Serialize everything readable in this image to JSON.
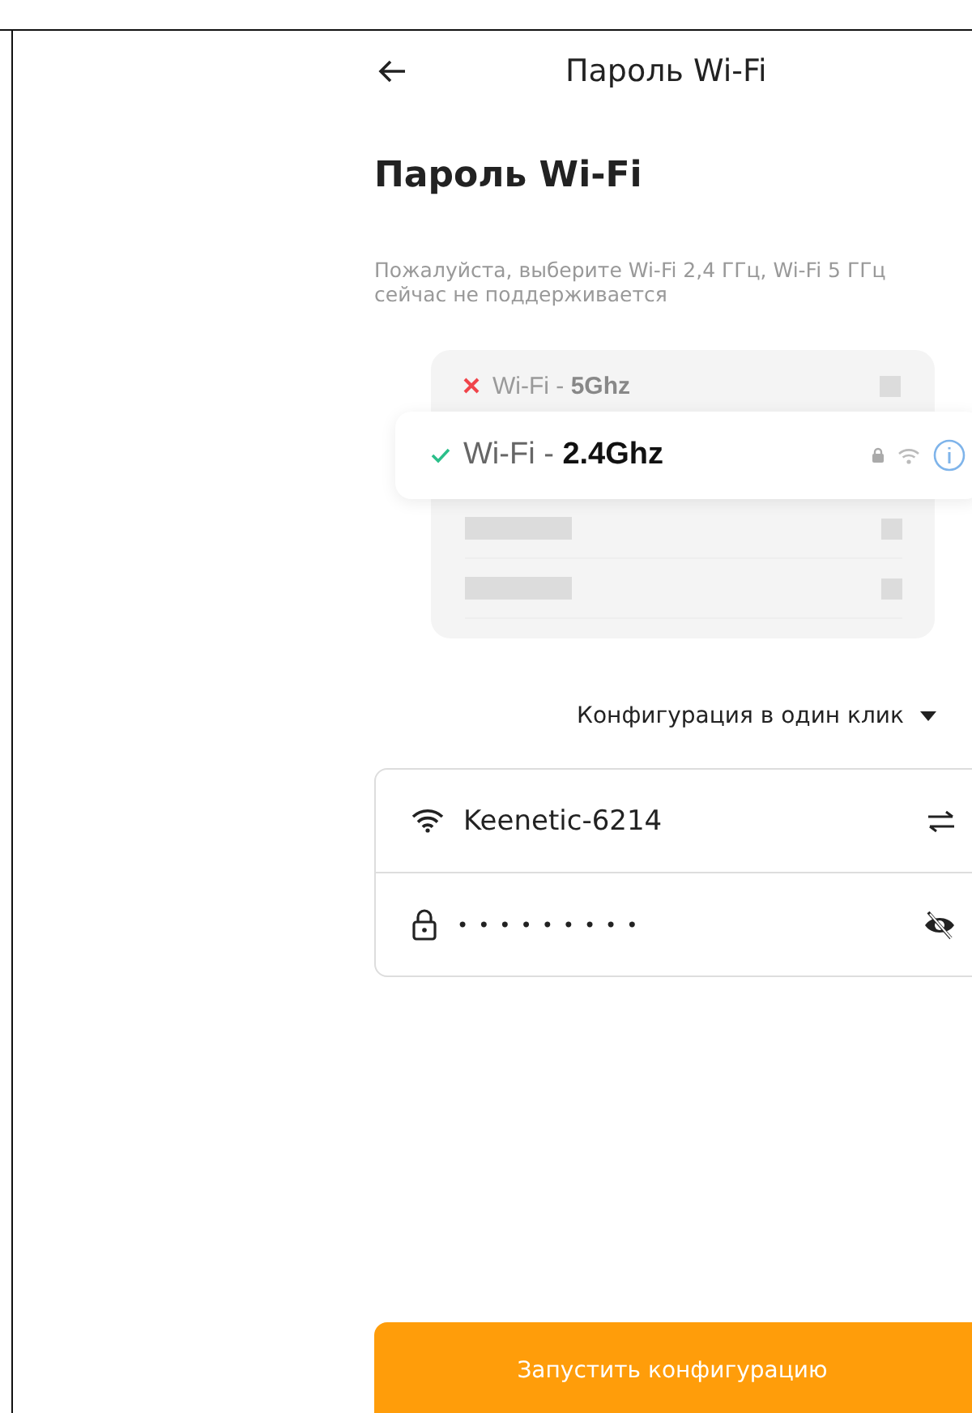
{
  "header": {
    "title": "Пароль Wi-Fi"
  },
  "heading": "Пароль Wi-Fi",
  "description": "Пожалуйста, выберите Wi-Fi 2,4 ГГц, Wi-Fi 5 ГГц сейчас не поддерживается",
  "illustration": {
    "bands": [
      {
        "prefix": "Wi-Fi - ",
        "band": "5Ghz",
        "supported": false
      },
      {
        "prefix": "Wi-Fi - ",
        "band": "2.4Ghz",
        "supported": true
      }
    ]
  },
  "mode_selector": "Конфигурация в один клик",
  "network": {
    "value": "Keenetic-6214"
  },
  "password": {
    "value": "•••••••••"
  },
  "start_button": "Запустить конфигурацию"
}
